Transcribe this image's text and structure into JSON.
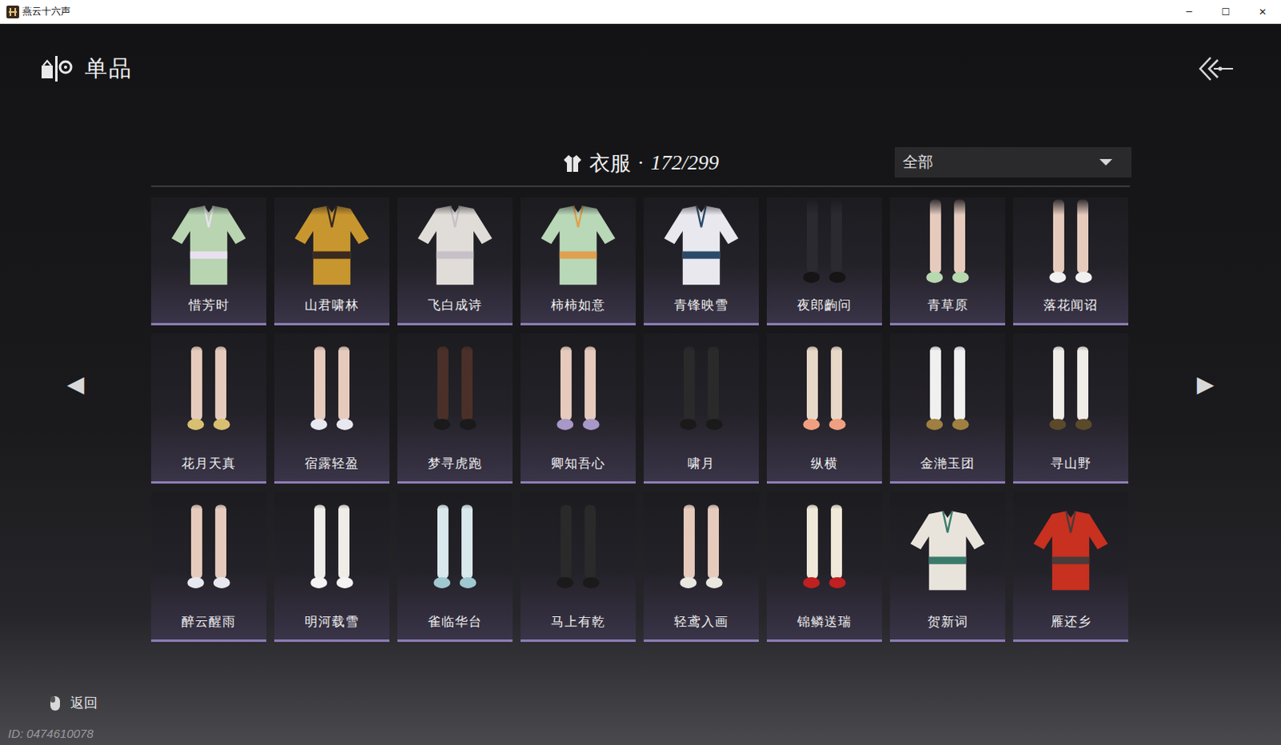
{
  "window": {
    "title": "燕云十六声",
    "controls": [
      "─",
      "☐",
      "✕"
    ]
  },
  "header": {
    "title": "单品"
  },
  "category": {
    "label": "衣服",
    "separator": "·",
    "count": "172/299"
  },
  "filter": {
    "value": "全部"
  },
  "pager": {
    "prev": "◀",
    "next": "▶"
  },
  "items": [
    {
      "name": "惜芳时",
      "kind": "top",
      "color": "#b8d4b0",
      "accent": "#e8e0f0"
    },
    {
      "name": "山君啸林",
      "kind": "top",
      "color": "#c8962e",
      "accent": "#3a2a20"
    },
    {
      "name": "飞白成诗",
      "kind": "top",
      "color": "#e0dcd8",
      "accent": "#c8c0c8"
    },
    {
      "name": "柿柿如意",
      "kind": "top",
      "color": "#b8d8b8",
      "accent": "#e0a050"
    },
    {
      "name": "青锋映雪",
      "kind": "top",
      "color": "#e8e8ee",
      "accent": "#2a4a6a"
    },
    {
      "name": "夜郎齣问",
      "kind": "legs",
      "color": "#2a2a30",
      "accent": "#151515"
    },
    {
      "name": "青草原",
      "kind": "legs",
      "color": "#e6cbbd",
      "accent": "#b8d8b0"
    },
    {
      "name": "落花闻诏",
      "kind": "legs",
      "color": "#e6cbbd",
      "accent": "#f0f0f0"
    },
    {
      "name": "花月天真",
      "kind": "legs",
      "color": "#e6cbbd",
      "accent": "#d8c070"
    },
    {
      "name": "宿露轻盈",
      "kind": "legs",
      "color": "#e6cbbd",
      "accent": "#e8e8f0"
    },
    {
      "name": "梦寻虎跑",
      "kind": "legs",
      "color": "#4a3028",
      "accent": "#1a1a1a"
    },
    {
      "name": "卿知吾心",
      "kind": "legs",
      "color": "#e6cbbd",
      "accent": "#a898c8"
    },
    {
      "name": "啸月",
      "kind": "legs",
      "color": "#2a2a2a",
      "accent": "#1a1a1a"
    },
    {
      "name": "纵横",
      "kind": "legs",
      "color": "#e8d8c8",
      "accent": "#f0a080"
    },
    {
      "name": "金滟玉团",
      "kind": "legs",
      "color": "#f0f0f0",
      "accent": "#a08040"
    },
    {
      "name": "寻山野",
      "kind": "legs",
      "color": "#f0ece8",
      "accent": "#5a4a2a"
    },
    {
      "name": "醉云醒雨",
      "kind": "legs",
      "color": "#e6cbbd",
      "accent": "#e8e8f0"
    },
    {
      "name": "明河载雪",
      "kind": "legs",
      "color": "#f0ece8",
      "accent": "#f4f4f4"
    },
    {
      "name": "雀临华台",
      "kind": "legs",
      "color": "#d8e8ec",
      "accent": "#a0c8d0"
    },
    {
      "name": "马上有乾",
      "kind": "legs",
      "color": "#2a2a2a",
      "accent": "#1a1a1a"
    },
    {
      "name": "轻鸢入画",
      "kind": "legs",
      "color": "#e6cbbd",
      "accent": "#e8e8e0"
    },
    {
      "name": "锦鳞送瑞",
      "kind": "legs",
      "color": "#f0e8d8",
      "accent": "#c02020"
    },
    {
      "name": "贺新词",
      "kind": "top",
      "color": "#e8e4dc",
      "accent": "#3a7a6a"
    },
    {
      "name": "雁还乡",
      "kind": "top",
      "color": "#c83020",
      "accent": "#4a3a3a"
    }
  ],
  "footer": {
    "back": "返回",
    "id": "ID: 0474610078"
  }
}
